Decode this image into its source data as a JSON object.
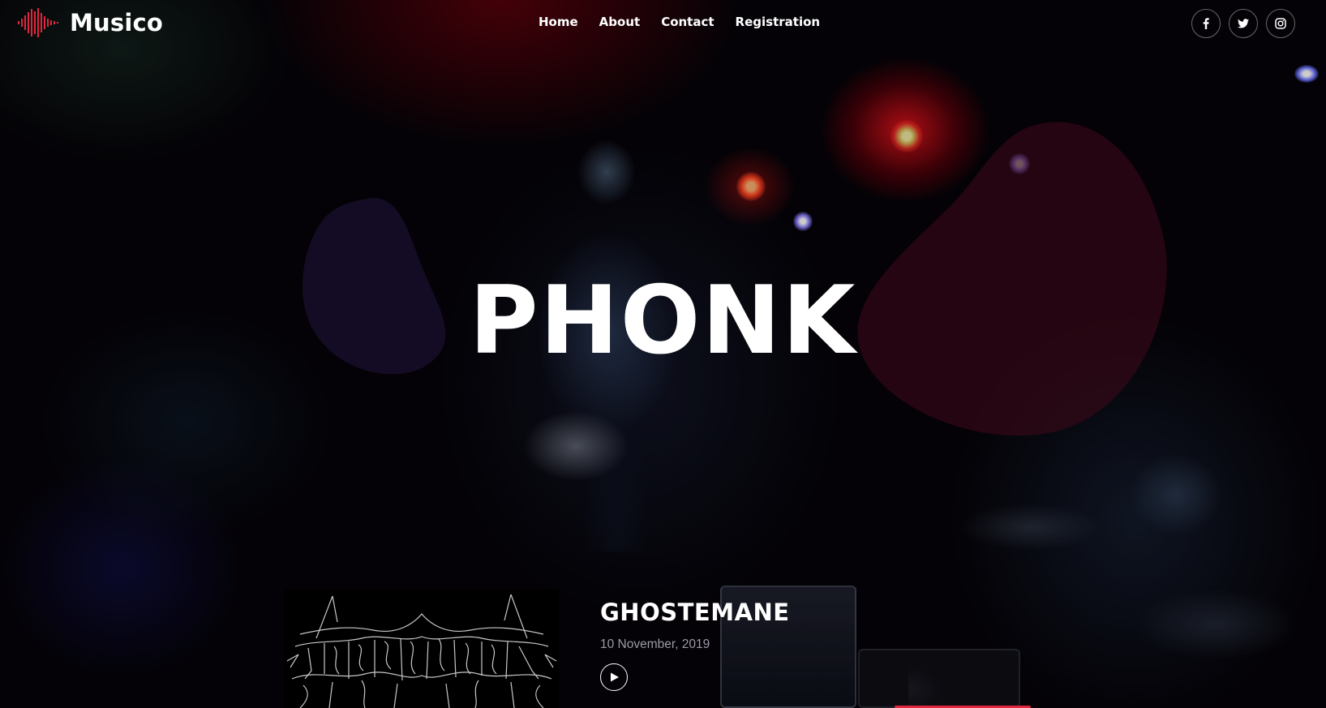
{
  "brand": {
    "name": "Musico",
    "icon": "sound-wave-icon",
    "accent_color": "#e2263d"
  },
  "nav": {
    "items": [
      {
        "label": "Home"
      },
      {
        "label": "About"
      },
      {
        "label": "Contact"
      },
      {
        "label": "Registration"
      }
    ]
  },
  "social": [
    {
      "icon": "facebook-icon"
    },
    {
      "icon": "twitter-icon"
    },
    {
      "icon": "instagram-icon"
    }
  ],
  "hero": {
    "title": "PHONK"
  },
  "featured_track": {
    "artist": "GHOSTEMANE",
    "date": "10 November, 2019",
    "play_icon": "play-icon"
  },
  "colors": {
    "blob_left": "#1a1030",
    "blob_right": "#3a0818",
    "date_text": "#9b9ba6"
  }
}
